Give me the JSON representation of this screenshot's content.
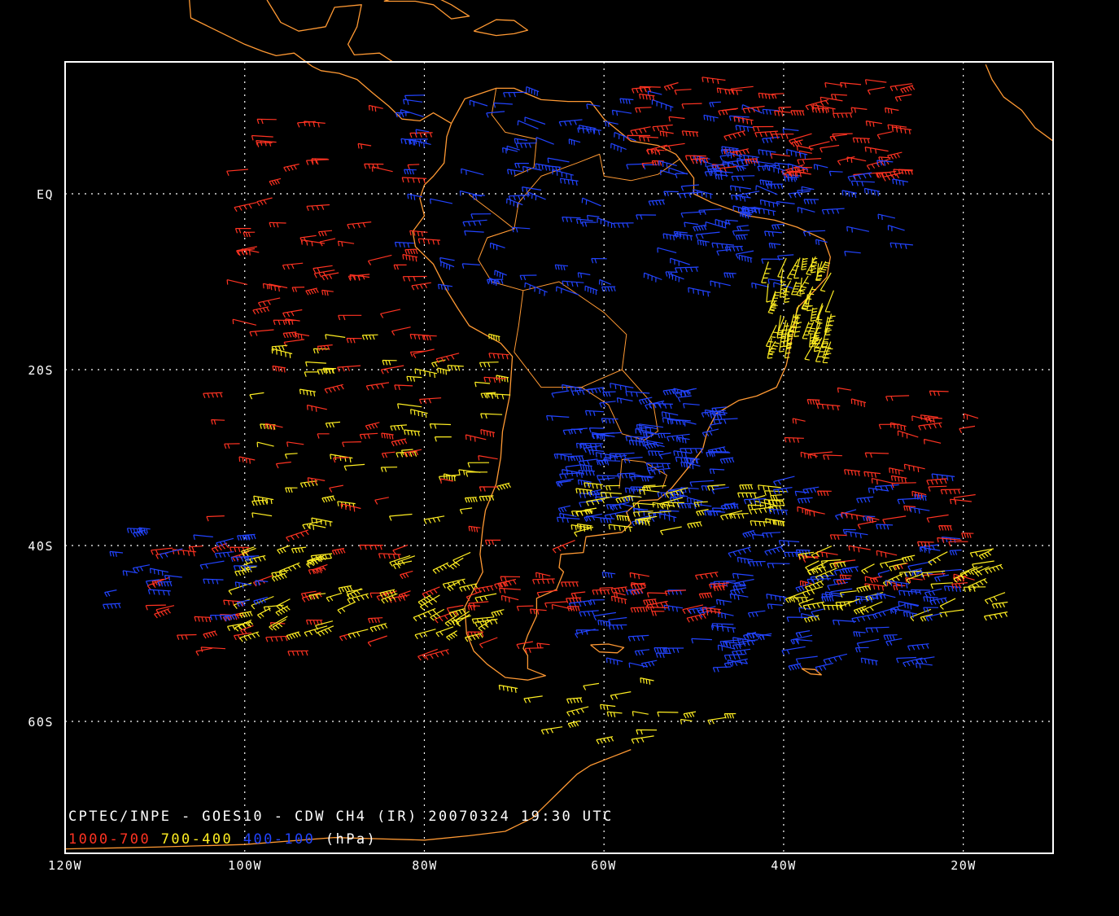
{
  "map": {
    "title": "CPTEC/INPE - GOES10 - CDW CH4 (IR) 20070324 19:30 UTC",
    "legend": {
      "range_low": "1000-700",
      "range_mid": "700-400",
      "range_high": "400-100",
      "unit": "(hPa)"
    },
    "lon_labels": [
      "120W",
      "100W",
      "80W",
      "60W",
      "40W",
      "20W"
    ],
    "lat_labels": [
      "EQ",
      "20S",
      "40S",
      "60S"
    ],
    "colors": {
      "background": "#000000",
      "frame": "#ffffff",
      "grid": "#ffffff",
      "coastline": "#ff9933",
      "low_level": "#ff3322",
      "mid_level": "#ffee22",
      "high_level": "#2244ff"
    },
    "extent": {
      "lon_min": -120,
      "lon_max": -10,
      "lat_min": -75,
      "lat_max": 15
    }
  }
}
